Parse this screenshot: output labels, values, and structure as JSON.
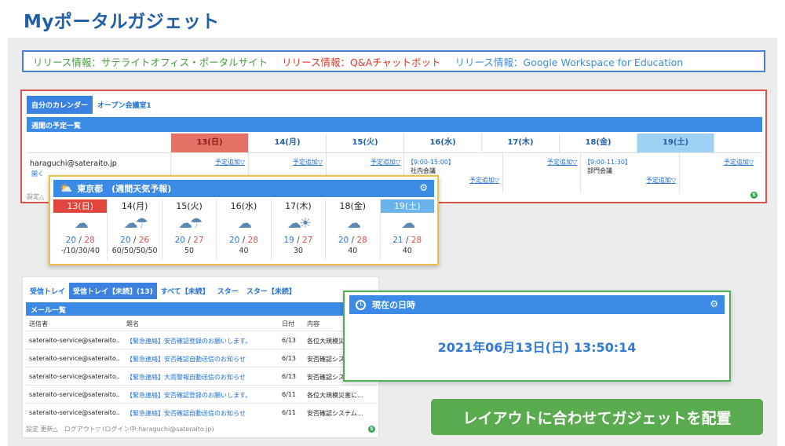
{
  "page": {
    "title": "Myポータルガジェット"
  },
  "release": {
    "items": [
      {
        "label": "リリース情報：サテライトオフィス・ポータルサイト",
        "color": "#4a9c3f"
      },
      {
        "label": "リリース情報：Q&Aチャットボット",
        "color": "#d63b2c"
      },
      {
        "label": "リリース情報：Google Workspace for Education",
        "color": "#3f8ed8"
      }
    ]
  },
  "calendar": {
    "tabs": [
      "自分のカレンダー",
      "オープン会議室1"
    ],
    "header": "週間の予定一覧",
    "days": [
      "13(日)",
      "14(月)",
      "15(火)",
      "16(水)",
      "17(木)",
      "18(金)",
      "19(土)"
    ],
    "user": "haraguchi@sateraito.jp",
    "open_label": "開く",
    "add_label": "予定追加▽",
    "events": {
      "wed": {
        "time": "【9:00-15:00】",
        "name": "社内会議"
      },
      "fri": {
        "time": "【9:00-11:30】",
        "name": "部門会議"
      }
    },
    "footer": "設定△"
  },
  "weather": {
    "title": "東京都　(週間天気予報)",
    "days": [
      {
        "date": "13(日)",
        "icon": "☁",
        "low": "20",
        "high": "28",
        "rain": "-/10/30/40"
      },
      {
        "date": "14(月)",
        "icon": "☁☂",
        "low": "20",
        "high": "26",
        "rain": "60/50/50/50"
      },
      {
        "date": "15(火)",
        "icon": "☁☂",
        "low": "20",
        "high": "27",
        "rain": "50"
      },
      {
        "date": "16(水)",
        "icon": "☁",
        "low": "20",
        "high": "28",
        "rain": "40"
      },
      {
        "date": "17(木)",
        "icon": "☁☀",
        "low": "19",
        "high": "27",
        "rain": "30"
      },
      {
        "date": "18(金)",
        "icon": "☁",
        "low": "20",
        "high": "28",
        "rain": "40"
      },
      {
        "date": "19(土)",
        "icon": "☁",
        "low": "21",
        "high": "28",
        "rain": "40"
      }
    ]
  },
  "mail": {
    "tabs": [
      "受信トレイ",
      "受信トレイ【未読】(13)",
      "すべて【未読】",
      "スター",
      "スター【未読】"
    ],
    "header": "メール一覧",
    "columns": {
      "from": "送信者",
      "subject": "題名",
      "date": "日付",
      "content": "内容"
    },
    "rows": [
      {
        "from": "sateraito-service@sateraito...",
        "subject": "【緊急連絡】安否確認登録のお願いします。",
        "date": "6/13",
        "content": "各位大規模災害..."
      },
      {
        "from": "sateraito-service@sateraito...",
        "subject": "【緊急連絡】安否確認自動送信のお知らせ",
        "date": "6/13",
        "content": "安否確認システ..."
      },
      {
        "from": "sateraito-service@sateraito...",
        "subject": "【緊急連絡】大雨警報自動送信のお知らせ",
        "date": "6/13",
        "content": "安否確認システ..."
      },
      {
        "from": "sateraito-service@sateraito...",
        "subject": "【緊急連絡】安否確認登録のお願いします。",
        "date": "6/11",
        "content": "各位大規模災害に..."
      },
      {
        "from": "sateraito-service@sateraito...",
        "subject": "【緊急連絡】安否確認自動送信のお知らせ",
        "date": "6/11",
        "content": "安否確認システム..."
      }
    ],
    "footer": "設定 更新△　ログアウト▽ (ログイン中:haraguchi@sateraito.jp)"
  },
  "datetime": {
    "title": "現在の日時",
    "value": "2021年06月13日(日) 13:50:14"
  },
  "banner": {
    "label": "レイアウトに合わせてガジェットを配置"
  }
}
